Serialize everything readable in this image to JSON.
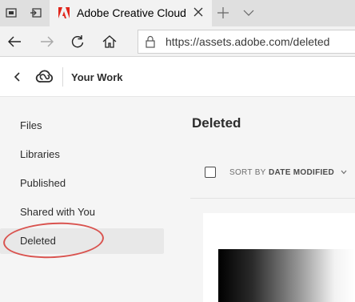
{
  "browser": {
    "tab_title": "Adobe Creative Cloud",
    "url": "https://assets.adobe.com/deleted"
  },
  "header": {
    "title": "Your Work"
  },
  "sidebar": {
    "items": [
      {
        "label": "Files"
      },
      {
        "label": "Libraries"
      },
      {
        "label": "Published"
      },
      {
        "label": "Shared with You"
      },
      {
        "label": "Deleted"
      }
    ],
    "selected": "Deleted"
  },
  "main": {
    "heading": "Deleted",
    "sort_label": "SORT BY",
    "sort_value": "DATE MODIFIED"
  },
  "colors": {
    "adobe_red": "#e1251b",
    "annotation": "#d9534f"
  },
  "icons": [
    "tab-preview-icon",
    "set-aside-icon",
    "adobe-logo-icon",
    "close-icon",
    "new-tab-icon",
    "tab-list-icon",
    "back-icon",
    "forward-icon",
    "refresh-icon",
    "home-icon",
    "lock-icon",
    "creative-cloud-icon",
    "chevron-down-icon"
  ]
}
